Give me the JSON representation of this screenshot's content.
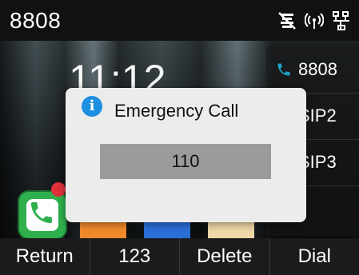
{
  "status_bar": {
    "account_number": "8808",
    "icons": [
      "dnd-icon",
      "wireless-icon",
      "network-icon"
    ]
  },
  "clock": {
    "time": "11:12"
  },
  "accounts": [
    {
      "label": "8808",
      "icon": "phone-icon"
    },
    {
      "label": "SIP2"
    },
    {
      "label": "SIP3"
    }
  ],
  "dialog": {
    "title": "Emergency Call",
    "icon": "info-icon",
    "number": "110"
  },
  "softkeys": {
    "return": "Return",
    "mode": "123",
    "delete": "Delete",
    "dial": "Dial"
  },
  "colors": {
    "info": "#1d8fe0",
    "phone_app": "#2fb04d",
    "badge": "#e0303a",
    "account_phone_icon": "#21a0c8"
  }
}
